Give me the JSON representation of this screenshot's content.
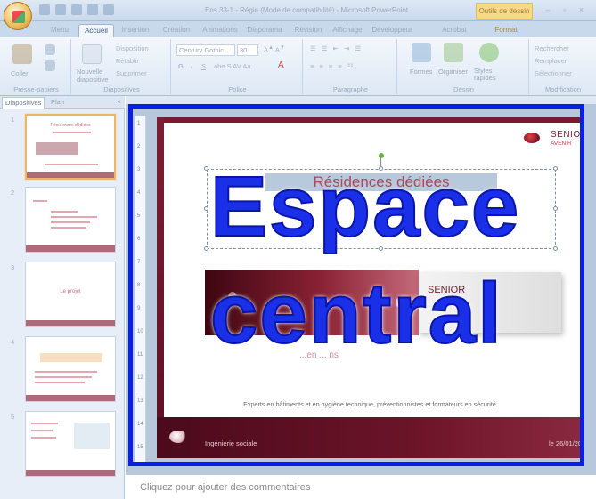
{
  "window": {
    "title": "Ens 33-1 - Régie (Mode de compatibilité) - Microsoft PowerPoint",
    "context_tab": "Outils de dessin",
    "controls": "–  ▫  ×"
  },
  "ribbon_tabs": [
    {
      "label": "Menu"
    },
    {
      "label": "Accueil"
    },
    {
      "label": "Insertion"
    },
    {
      "label": "Création"
    },
    {
      "label": "Animations"
    },
    {
      "label": "Diaporama"
    },
    {
      "label": "Révision"
    },
    {
      "label": "Affichage"
    },
    {
      "label": "Développeur"
    },
    {
      "label": "Acrobat"
    },
    {
      "label": "Format"
    }
  ],
  "ribbon": {
    "clipboard": {
      "paste": "Coller",
      "group": "Presse-papiers"
    },
    "slides": {
      "new": "Nouvelle diapositive",
      "layout": "Disposition",
      "reset": "Rétablir",
      "delete": "Supprimer",
      "group": "Diapositives"
    },
    "font": {
      "name": "Century Gothic",
      "size": "30",
      "group": "Police",
      "bold": "G",
      "italic": "I",
      "underline": "S"
    },
    "paragraph": {
      "group": "Paragraphe"
    },
    "drawing": {
      "shapes": "Formes",
      "arrange": "Organiser",
      "styles": "Styles rapides",
      "group": "Dessin"
    },
    "editing": {
      "find": "Rechercher",
      "replace": "Remplacer",
      "select": "Sélectionner",
      "group": "Modification"
    }
  },
  "pane": {
    "tab_slides": "Diapositives",
    "tab_outline": "Plan",
    "close": "×",
    "thumbs": [
      {
        "num": "1",
        "title": "Résidences dédiées"
      },
      {
        "num": "2",
        "title": ""
      },
      {
        "num": "3",
        "title": "Le projet"
      },
      {
        "num": "4",
        "title": ""
      },
      {
        "num": "5",
        "title": ""
      }
    ]
  },
  "ruler_numbers": [
    "1",
    "2",
    "3",
    "4",
    "5",
    "6",
    "7",
    "8",
    "9",
    "10",
    "11",
    "12",
    "13",
    "14",
    "15"
  ],
  "slide": {
    "logo": "SENIOR",
    "logo_sub": "AVENIR",
    "title_line1": "Résidences dédiées",
    "title_line2": "",
    "photo_brand": "SENIOR",
    "sub_text": "...en ... ns",
    "description": "Experts en bâtiments et en hygiène technique, préventionnistes et formateurs en sécurité.",
    "footer": "Ingénierie sociale",
    "date": "le 26/01/20"
  },
  "overlay": {
    "word1": "Espace",
    "word2": "central",
    "color": "#0a1fe6"
  },
  "notes": {
    "placeholder": "Cliquez pour ajouter des commentaires"
  }
}
